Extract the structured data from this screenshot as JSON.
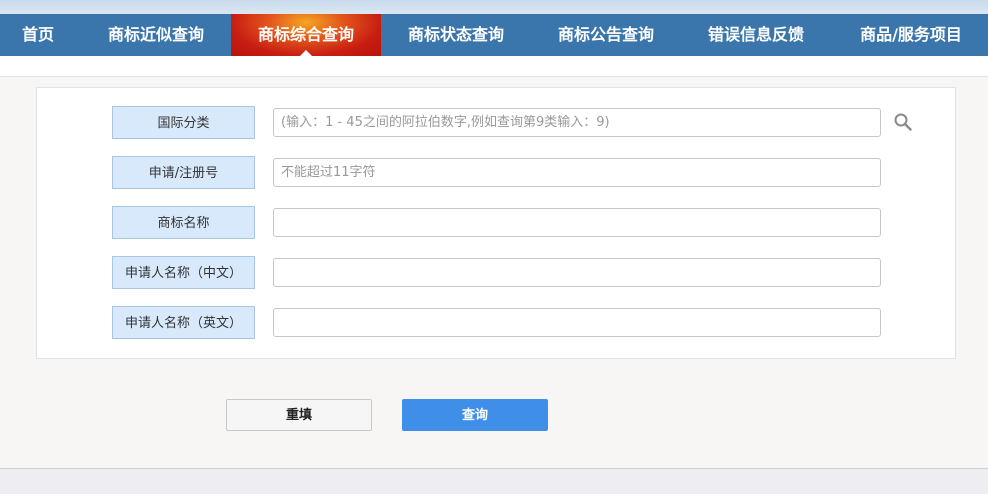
{
  "nav": {
    "items": [
      {
        "label": "首页",
        "active": false
      },
      {
        "label": "商标近似查询",
        "active": false
      },
      {
        "label": "商标综合查询",
        "active": true
      },
      {
        "label": "商标状态查询",
        "active": false
      },
      {
        "label": "商标公告查询",
        "active": false
      },
      {
        "label": "错误信息反馈",
        "active": false
      },
      {
        "label": "商品/服务项目",
        "active": false
      }
    ]
  },
  "form": {
    "fields": [
      {
        "label": "国际分类",
        "value": "",
        "placeholder": "(输入：1 - 45之间的阿拉伯数字,例如查询第9类输入：9)"
      },
      {
        "label": "申请/注册号",
        "value": "",
        "placeholder": "不能超过11字符"
      },
      {
        "label": "商标名称",
        "value": "",
        "placeholder": ""
      },
      {
        "label": "申请人名称（中文）",
        "value": "",
        "placeholder": ""
      },
      {
        "label": "申请人名称（英文）",
        "value": "",
        "placeholder": ""
      }
    ]
  },
  "buttons": {
    "reset": "重填",
    "query": "查询"
  },
  "icons": {
    "search": "search-icon"
  },
  "colors": {
    "nav_bg": "#3a76ab",
    "nav_active": "#c81d12",
    "label_bg": "#d8e9fb",
    "query_button": "#3f8fe8"
  }
}
